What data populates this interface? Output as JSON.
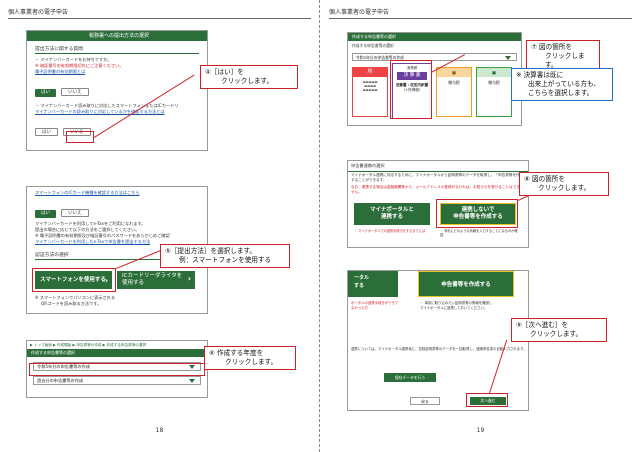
{
  "header_title": "個人事業者の電子申告",
  "left": {
    "page_number": "18",
    "s1": {
      "bar": "税務署への提出方法の選択",
      "heading": "提出方法に関する質問",
      "q1": "・ マイナンバーカードをお持ちですか。",
      "note1": "※ 暗証番号の有効期限切れにご注意ください。",
      "link1": "電子証明書の有効期限とは",
      "yes": "はい",
      "no": "いいえ",
      "q2": "・ マイナンバーカード読み取りに対応したスマートフォンまたはICカードリ",
      "link2": "マイナンバーカードの読み取りに対応しているかを確認する方法とは"
    },
    "s2": {
      "link_top": "スマートフォンのICカード機種を確認する方法はこちら",
      "yes": "はい",
      "no": "いいえ",
      "t1": "マイナンバーカードを利用してe-Taxをご利用になれます。",
      "t2": "提出の場合に応じて以下の方法をご選択してください。",
      "t3": "※ 電子証明書の有効期限及び暗証番号のパスワードをあらかじめご確認",
      "t4": "マイナンバーカードを利用したe-Taxで申告書を提出する方法",
      "method_heading": "認証方法の選択",
      "btn_smartphone": "スマートフォンを使用する",
      "btn_icreader_1": "ICカードリーダライタを",
      "btn_icreader_2": "使用する",
      "n1": "※ スマートフォンでパソコンに表示される",
      "n2": "QRコードを読み取る方法です。"
    },
    "s3": {
      "crumb": "▶ トップ画面 ▶ 作成開始 ▶ 申告書等の作成 ▶ 作成する申告書等の選択",
      "bar": "作成する申告書等の選択",
      "dd1": "令和5年分の申告書等の作成",
      "dd2": "過去分の申告書等の作成"
    },
    "c4": {
      "l1": "④［はい］を",
      "l2": "クリックします。"
    },
    "c5": {
      "l1": "⑤［提出方法］を選択します。",
      "l2": "例：スマートフォンを使用する"
    },
    "c6": {
      "l1": "⑥ 作成する年度を",
      "l2": "クリックします。"
    }
  },
  "right": {
    "page_number": "19",
    "s1": {
      "bar": "作成する申告書等の選択",
      "sub1": "作成する申告書等の選択",
      "sel": "令和5年分の申告書等の作成",
      "tile1": "所",
      "tile2_a": "消費税",
      "tile2_b": "決 算 書",
      "tile2_c": "決算書・収支内訳書",
      "tile2_d": "（+所得税）",
      "tile3": "贈与税",
      "tile4": "青色申告",
      "tile5": "贈与税"
    },
    "c7": {
      "l1": "⑦ 図の箇所を",
      "l2": "クリックします。"
    },
    "note": {
      "l1": "※ 決算書は既に",
      "l2": "出来上がっている方も、",
      "l3": "こちらを選択します。"
    },
    "s2": {
      "title": "申告書連携の選択",
      "t1": "マイナポータル連携に対応するために、マイナポータルから証明書等のデータを取得し、「申告書等を作成することができます。",
      "t2": "なお、連携する場合は金融機関等から、メールアドレスの登録がなければ、お知らせを受けることはできません。",
      "btn_mp_1": "マイナポータルと",
      "btn_mp_2": "連携する",
      "btn_no_1": "連携しないで",
      "btn_no_2": "申告書等を作成する",
      "n1": "・ マイナポータルでの連携手続きをするまでには",
      "n2": "・ 事前にどのような情報を入力することになるのか確認"
    },
    "c8": {
      "l1": "⑧ 図の箇所を",
      "l2": "クリックします。"
    },
    "s3": {
      "top_btn": "申告書等を作成する",
      "left_frag1": "ータル",
      "left_frag2": "する",
      "l1": "ポータルの連携手続きができて",
      "l2": "なかった方",
      "r1": "・ 事前に取り込みたい証明書等の情報を確認し",
      "r2": "マイナポータルに連携しておいてください。",
      "mid": "連携については、マイナポータル連携後に、控除証明書等のデータを一括取得し、連絡申告書の自動入力されます。",
      "file_btn": "保存データを行う",
      "back": "戻る",
      "next": "次へ進む"
    },
    "c9": {
      "l1": "⑨［次へ進む］を",
      "l2": "クリックします。"
    }
  }
}
